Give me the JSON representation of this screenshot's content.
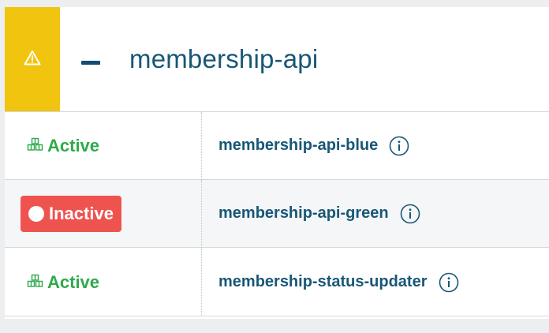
{
  "group": {
    "title": "membership-api",
    "warning_icon": "warning-triangle-icon",
    "collapse_icon": "minus-icon",
    "colors": {
      "warning_bg": "#f1c40f",
      "title": "#185776",
      "active": "#2eaa4b",
      "inactive_bg": "#ef5350"
    }
  },
  "services": [
    {
      "status": "Active",
      "status_icon": "cubes-icon",
      "name": "membership-api-blue",
      "info_icon": "info-icon"
    },
    {
      "status": "Inactive",
      "status_icon": "circle-icon",
      "name": "membership-api-green",
      "info_icon": "info-icon"
    },
    {
      "status": "Active",
      "status_icon": "cubes-icon",
      "name": "membership-status-updater",
      "info_icon": "info-icon"
    }
  ]
}
